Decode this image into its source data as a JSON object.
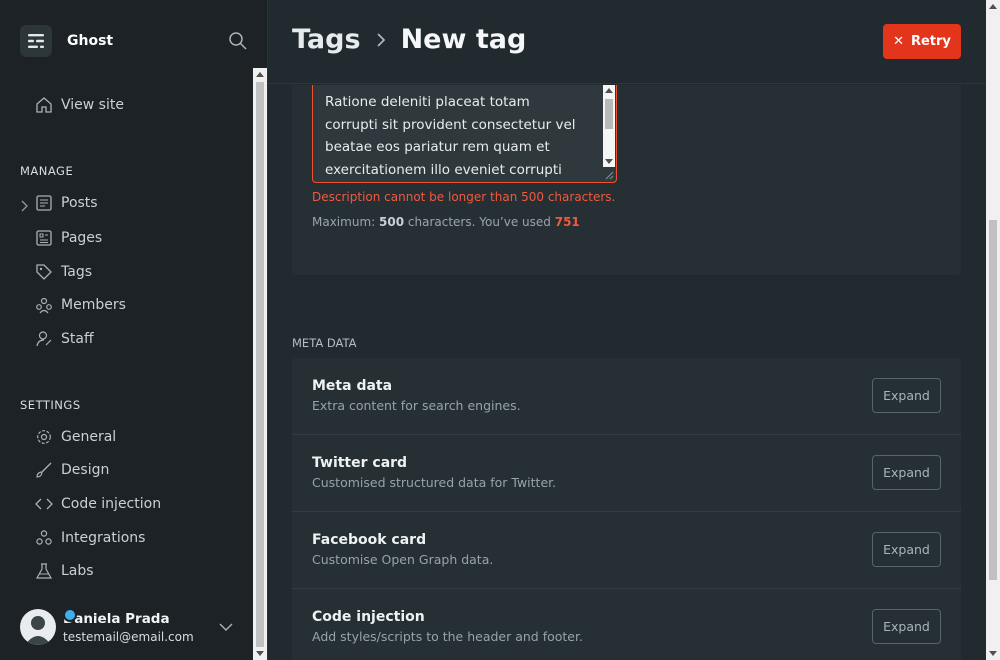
{
  "sidebar": {
    "brand": "Ghost",
    "view_site": "View site",
    "manage_label": "MANAGE",
    "manage_items": [
      {
        "label": "Posts",
        "icon": "posts-icon"
      },
      {
        "label": "Pages",
        "icon": "pages-icon"
      },
      {
        "label": "Tags",
        "icon": "tag-icon"
      },
      {
        "label": "Members",
        "icon": "members-icon"
      },
      {
        "label": "Staff",
        "icon": "staff-icon"
      }
    ],
    "settings_label": "SETTINGS",
    "settings_items": [
      {
        "label": "General",
        "icon": "gear-icon"
      },
      {
        "label": "Design",
        "icon": "brush-icon"
      },
      {
        "label": "Code injection",
        "icon": "code-icon"
      },
      {
        "label": "Integrations",
        "icon": "integrations-icon"
      },
      {
        "label": "Labs",
        "icon": "flask-icon"
      }
    ],
    "user": {
      "name": "Daniela Prada",
      "email": "testemail@email.com"
    }
  },
  "header": {
    "crumb_parent": "Tags",
    "crumb_current": "New tag",
    "retry_label": "Retry"
  },
  "description": {
    "text": "Ratione deleniti placeat totam\ncorrupti sit provident consectetur vel\nbeatae eos pariatur rem quam et\nexercitationem illo eveniet corrupti",
    "error": "Description cannot be longer than 500 characters.",
    "limit_prefix": "Maximum:",
    "limit_max": "500",
    "limit_middle": "characters. You’ve used",
    "limit_used": "751"
  },
  "meta": {
    "heading": "META DATA",
    "rows": [
      {
        "title": "Meta data",
        "desc": "Extra content for search engines.",
        "button": "Expand"
      },
      {
        "title": "Twitter card",
        "desc": "Customised structured data for Twitter.",
        "button": "Expand"
      },
      {
        "title": "Facebook card",
        "desc": "Customise Open Graph data.",
        "button": "Expand"
      },
      {
        "title": "Code injection",
        "desc": "Add styles/scripts to the header and footer.",
        "button": "Expand"
      }
    ]
  },
  "colors": {
    "accent_red": "#e2351c",
    "presence": "#3eb0ef"
  }
}
